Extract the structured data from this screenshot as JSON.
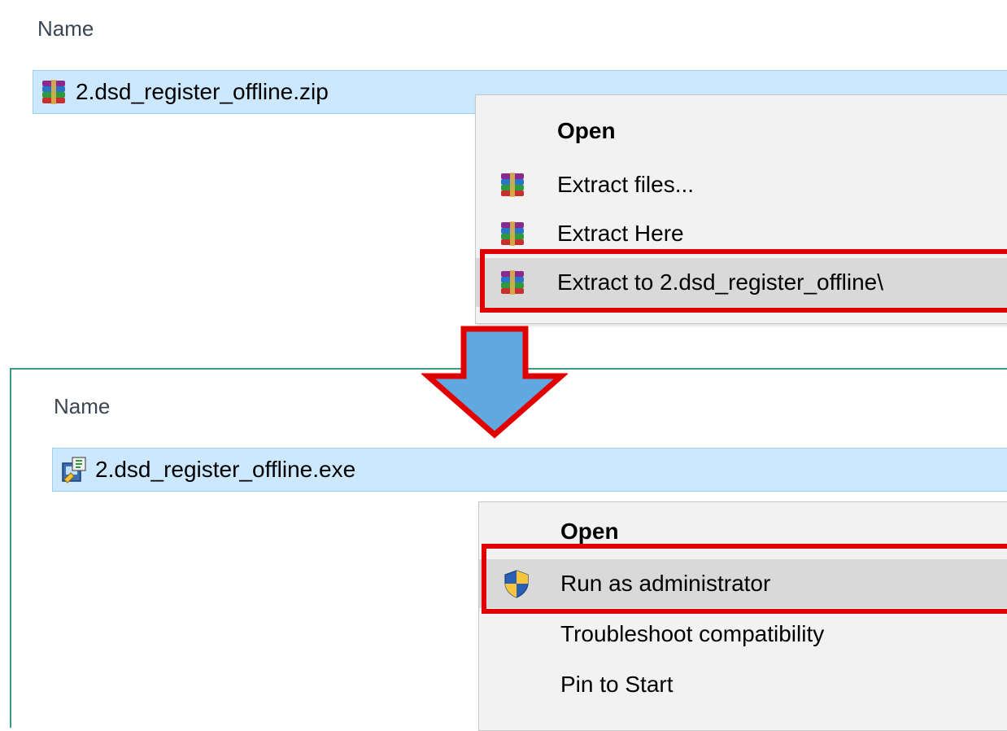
{
  "top": {
    "column_header": "Name",
    "file_name": "2.dsd_register_offline.zip",
    "file_icon": "winrar-archive-icon",
    "menu": [
      {
        "label": "Open",
        "icon": "",
        "bold": true
      },
      {
        "label": "Extract files...",
        "icon": "winrar-archive-icon",
        "bold": false
      },
      {
        "label": "Extract Here",
        "icon": "winrar-archive-icon",
        "bold": false
      },
      {
        "label": "Extract to 2.dsd_register_offline\\",
        "icon": "winrar-archive-icon",
        "bold": false,
        "highlighted": true
      }
    ]
  },
  "bottom": {
    "column_header": "Name",
    "file_name": "2.dsd_register_offline.exe",
    "file_icon": "installer-exe-icon",
    "menu": [
      {
        "label": "Open",
        "icon": "",
        "bold": true
      },
      {
        "label": "Run as administrator",
        "icon": "uac-shield-icon",
        "bold": false,
        "highlighted": true
      },
      {
        "label": "Troubleshoot compatibility",
        "icon": "",
        "bold": false
      },
      {
        "label": "Pin to Start",
        "icon": "",
        "bold": false
      }
    ]
  },
  "colors": {
    "selection_bg": "#cce8ff",
    "menu_bg": "#f2f2f2",
    "highlight_red": "#e00000",
    "arrow_fill": "#5fa8e0",
    "panel_border": "#3a9a83"
  }
}
